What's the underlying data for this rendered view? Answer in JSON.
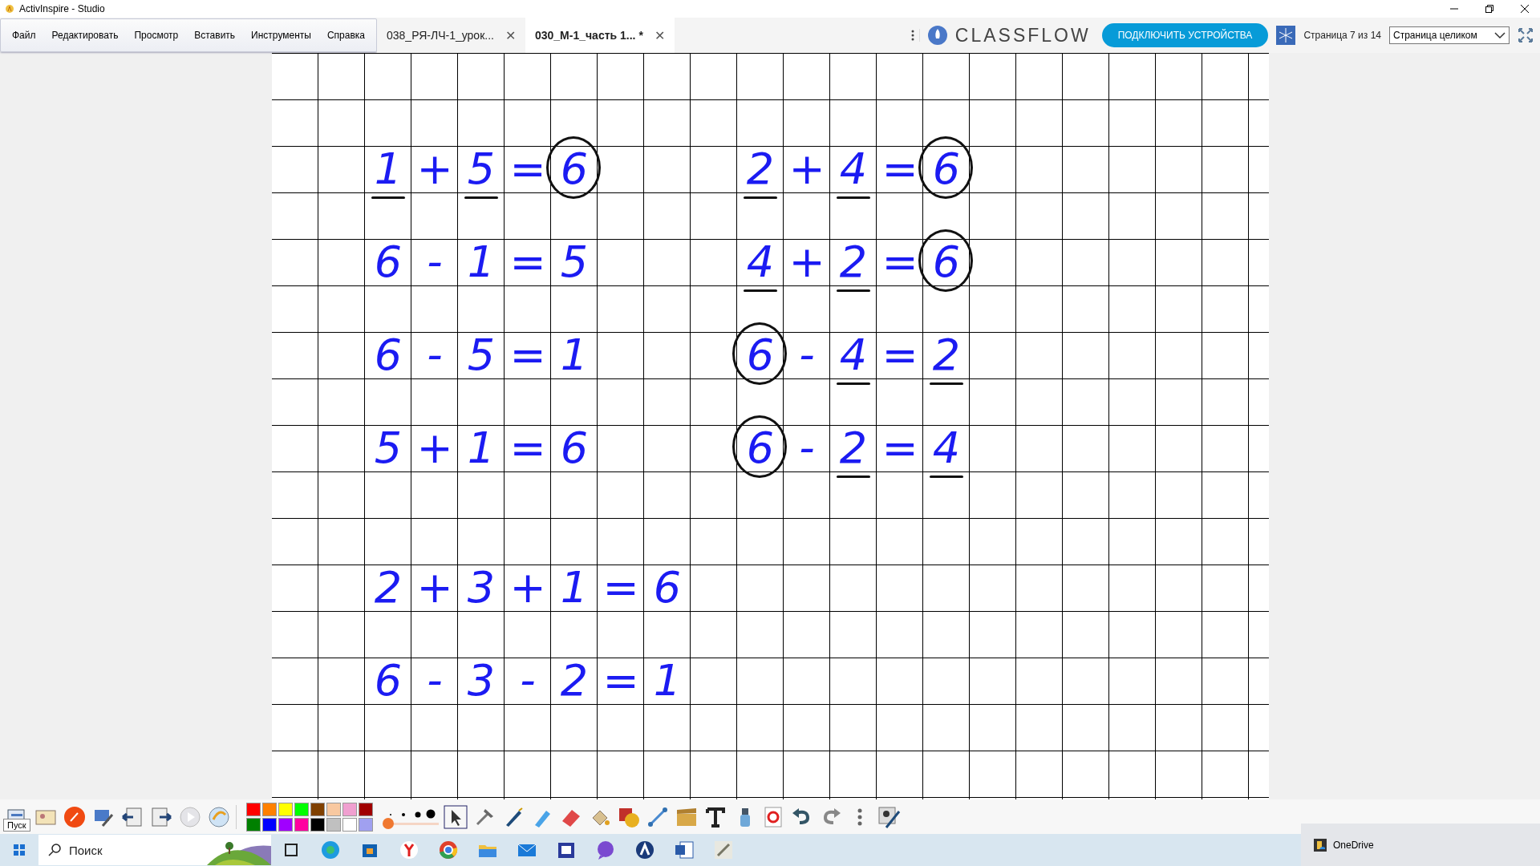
{
  "window": {
    "title": "ActivInspire - Studio"
  },
  "menu": [
    "Файл",
    "Редактировать",
    "Просмотр",
    "Вставить",
    "Инструменты",
    "Справка"
  ],
  "tabs": [
    {
      "label": "038_РЯ-ЛЧ-1_урок...",
      "selected": false,
      "close": "✕"
    },
    {
      "label": "030_М-1_часть 1... *",
      "selected": true,
      "close": "✕"
    }
  ],
  "classflow": {
    "brand": "CLASSFLOW",
    "connect_button": "ПОДКЛЮЧИТЬ УСТРОЙСТВА"
  },
  "page_indicator": "Страница 7 из 14",
  "zoom_select": {
    "value": "Страница целиком"
  },
  "canvas": {
    "equations": [
      {
        "tokens": [
          {
            "t": "1",
            "underlined": true,
            "circled": false
          },
          {
            "t": "+",
            "underlined": false,
            "circled": false
          },
          {
            "t": "5",
            "underlined": true,
            "circled": false
          },
          {
            "t": "=",
            "underlined": false,
            "circled": false
          },
          {
            "t": "6",
            "underlined": false,
            "circled": true
          }
        ]
      },
      {
        "tokens": [
          {
            "t": "2",
            "underlined": true,
            "circled": false
          },
          {
            "t": "+",
            "underlined": false,
            "circled": false
          },
          {
            "t": "4",
            "underlined": true,
            "circled": false
          },
          {
            "t": "=",
            "underlined": false,
            "circled": false
          },
          {
            "t": "6",
            "underlined": false,
            "circled": true
          }
        ]
      },
      {
        "tokens": [
          {
            "t": "6",
            "underlined": false,
            "circled": false
          },
          {
            "t": "-",
            "underlined": false,
            "circled": false
          },
          {
            "t": "1",
            "underlined": false,
            "circled": false
          },
          {
            "t": "=",
            "underlined": false,
            "circled": false
          },
          {
            "t": "5",
            "underlined": false,
            "circled": false
          }
        ]
      },
      {
        "tokens": [
          {
            "t": "4",
            "underlined": true,
            "circled": false
          },
          {
            "t": "+",
            "underlined": false,
            "circled": false
          },
          {
            "t": "2",
            "underlined": true,
            "circled": false
          },
          {
            "t": "=",
            "underlined": false,
            "circled": false
          },
          {
            "t": "6",
            "underlined": false,
            "circled": true
          }
        ]
      },
      {
        "tokens": [
          {
            "t": "6",
            "underlined": false,
            "circled": false
          },
          {
            "t": "-",
            "underlined": false,
            "circled": false
          },
          {
            "t": "5",
            "underlined": false,
            "circled": false
          },
          {
            "t": "=",
            "underlined": false,
            "circled": false
          },
          {
            "t": "1",
            "underlined": false,
            "circled": false
          }
        ]
      },
      {
        "tokens": [
          {
            "t": "6",
            "underlined": false,
            "circled": true
          },
          {
            "t": "-",
            "underlined": false,
            "circled": false
          },
          {
            "t": "4",
            "underlined": true,
            "circled": false
          },
          {
            "t": "=",
            "underlined": false,
            "circled": false
          },
          {
            "t": "2",
            "underlined": true,
            "circled": false
          }
        ]
      },
      {
        "tokens": [
          {
            "t": "5",
            "underlined": false,
            "circled": false
          },
          {
            "t": "+",
            "underlined": false,
            "circled": false
          },
          {
            "t": "1",
            "underlined": false,
            "circled": false
          },
          {
            "t": "=",
            "underlined": false,
            "circled": false
          },
          {
            "t": "6",
            "underlined": false,
            "circled": false
          }
        ]
      },
      {
        "tokens": [
          {
            "t": "6",
            "underlined": false,
            "circled": true
          },
          {
            "t": "-",
            "underlined": false,
            "circled": false
          },
          {
            "t": "2",
            "underlined": true,
            "circled": false
          },
          {
            "t": "=",
            "underlined": false,
            "circled": false
          },
          {
            "t": "4",
            "underlined": true,
            "circled": false
          }
        ]
      },
      {
        "tokens": [
          {
            "t": "2",
            "underlined": false,
            "circled": false
          },
          {
            "t": "+",
            "underlined": false,
            "circled": false
          },
          {
            "t": "3",
            "underlined": false,
            "circled": false
          },
          {
            "t": "+",
            "underlined": false,
            "circled": false
          },
          {
            "t": "1",
            "underlined": false,
            "circled": false
          },
          {
            "t": "=",
            "underlined": false,
            "circled": false
          },
          {
            "t": "6",
            "underlined": false,
            "circled": false
          }
        ]
      },
      {
        "tokens": [
          {
            "t": "6",
            "underlined": false,
            "circled": false
          },
          {
            "t": "-",
            "underlined": false,
            "circled": false
          },
          {
            "t": "3",
            "underlined": false,
            "circled": false
          },
          {
            "t": "-",
            "underlined": false,
            "circled": false
          },
          {
            "t": "2",
            "underlined": false,
            "circled": false
          },
          {
            "t": "=",
            "underlined": false,
            "circled": false
          },
          {
            "t": "1",
            "underlined": false,
            "circled": false
          }
        ]
      }
    ]
  },
  "palette": [
    {
      "color": "#ff0000"
    },
    {
      "color": "#ff8000"
    },
    {
      "color": "#ffff00"
    },
    {
      "color": "#00ff00"
    },
    {
      "color": "#804000"
    },
    {
      "color": "#f8c8a0"
    },
    {
      "color": "#f0a0d0"
    },
    {
      "color": "#a00000"
    },
    {
      "color": "#008000"
    },
    {
      "color": "#0000ff"
    },
    {
      "color": "#a000ff"
    },
    {
      "color": "#ff00a0"
    },
    {
      "color": "#000000"
    },
    {
      "color": "#c0c0c0"
    },
    {
      "color": "#ffffff"
    },
    {
      "color": "#a0a0f0"
    }
  ],
  "pen_width": {
    "level": 0
  },
  "tooltip": "Пуск",
  "taskbar": {
    "search": {
      "placeholder": "Поиск"
    }
  },
  "notification": {
    "label": "OneDrive"
  }
}
